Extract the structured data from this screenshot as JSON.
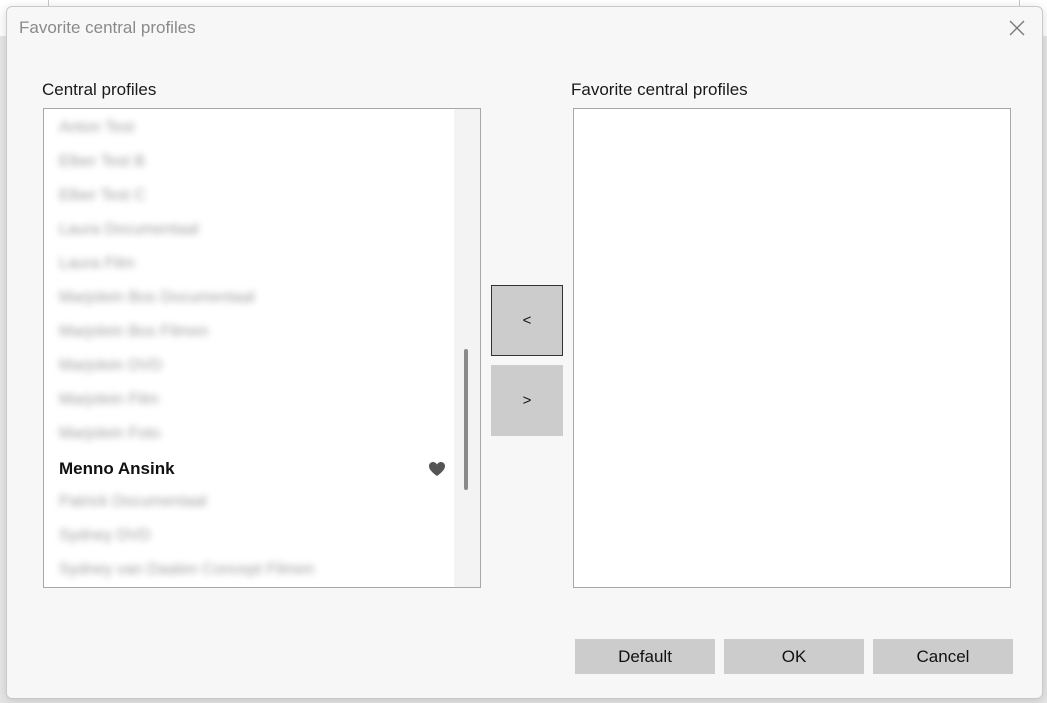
{
  "dialog": {
    "title": "Favorite central profiles",
    "close_icon": "close-icon"
  },
  "left_panel": {
    "label": "Central profiles",
    "items": [
      {
        "label": "Anton Test",
        "blurred": true
      },
      {
        "label": "Elber Test B",
        "blurred": true
      },
      {
        "label": "Elber Test C",
        "blurred": true
      },
      {
        "label": "Laura Documentaal",
        "blurred": true
      },
      {
        "label": "Laura Film",
        "blurred": true
      },
      {
        "label": "Marjolein Bos Documentaal",
        "blurred": true
      },
      {
        "label": "Marjolein Bos Filmen",
        "blurred": true
      },
      {
        "label": "Marjolein DVD",
        "blurred": true
      },
      {
        "label": "Marjolein Film",
        "blurred": true
      },
      {
        "label": "Marjolein Foto",
        "blurred": true
      },
      {
        "label": "Menno Ansink",
        "blurred": false,
        "favorite": true
      },
      {
        "label": "Patrick Documentaal",
        "blurred": true
      },
      {
        "label": "Sydney DVD",
        "blurred": true
      },
      {
        "label": "Sydney van Daalen Concept Filmen",
        "blurred": true
      }
    ],
    "favorite_icon": "heart-icon"
  },
  "move_buttons": {
    "remove_label": "<",
    "add_label": ">"
  },
  "right_panel": {
    "label": "Favorite central profiles",
    "items": []
  },
  "footer": {
    "default_label": "Default",
    "ok_label": "OK",
    "cancel_label": "Cancel"
  }
}
